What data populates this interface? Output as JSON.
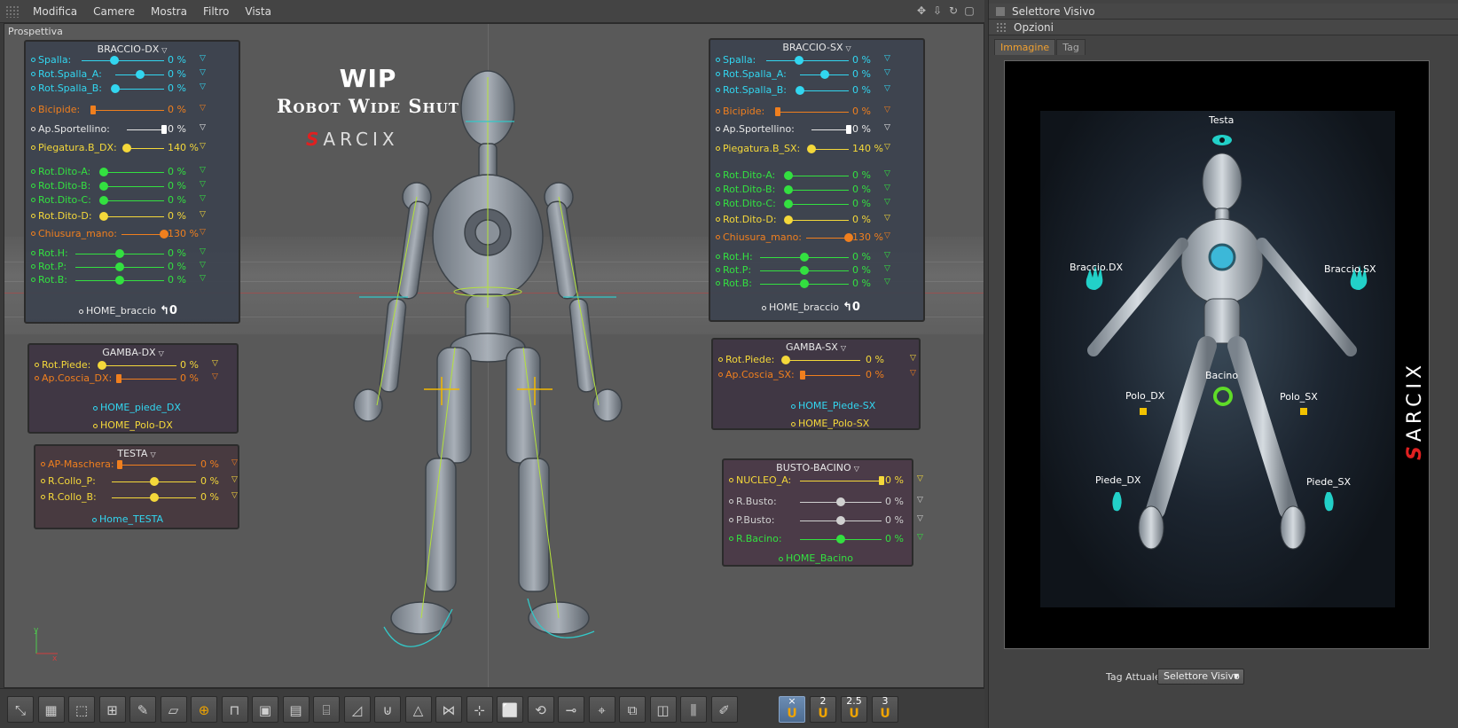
{
  "menubar": {
    "items": [
      "Modifica",
      "Camere",
      "Mostra",
      "Filtro",
      "Vista"
    ]
  },
  "viewport": {
    "label": "Prospettiva",
    "title": "WIP",
    "subtitle": "Robot Wide Shut",
    "brand_first": "S",
    "brand_rest": "ARCIX"
  },
  "colors": {
    "cyan": "#32d6f0",
    "orange": "#f07f1e",
    "white": "#e8e8e8",
    "yellow": "#f4d83a",
    "green": "#33e040",
    "grey": "#d0d0d0",
    "accent_tab": "#f0a030",
    "marker_yellow": "#f2c200"
  },
  "panels": {
    "braccio_dx": {
      "title": "BRACCIO-DX",
      "controls": [
        {
          "label": "Spalla:",
          "value": "0 %",
          "color": "cyan",
          "level": 0.4
        },
        {
          "label": "Rot.Spalla_A:",
          "value": "0 %",
          "color": "cyan",
          "level": 0.5
        },
        {
          "label": "Rot.Spalla_B:",
          "value": "0 %",
          "color": "cyan",
          "level": 0.0
        },
        {
          "label": "Bicipide:",
          "value": "0 %",
          "color": "orange",
          "level": 0.0
        },
        {
          "label": "Ap.Sportellino:",
          "value": "0 %",
          "color": "white",
          "level": 1.0
        },
        {
          "label": "Piegatura.B_DX:",
          "value": "140 %",
          "color": "yellow",
          "level": 0.0
        },
        {
          "label": "Rot.Dito-A:",
          "value": "0 %",
          "color": "green",
          "level": 0.0
        },
        {
          "label": "Rot.Dito-B:",
          "value": "0 %",
          "color": "green",
          "level": 0.0
        },
        {
          "label": "Rot.Dito-C:",
          "value": "0 %",
          "color": "green",
          "level": 0.0
        },
        {
          "label": "Rot.Dito-D:",
          "value": "0 %",
          "color": "yellow",
          "level": 0.0
        },
        {
          "label": "Chiusura_mano:",
          "value": "130 %",
          "color": "orange",
          "level": 1.0
        },
        {
          "label": "Rot.H:",
          "value": "0 %",
          "color": "green",
          "level": 0.5
        },
        {
          "label": "Rot.P:",
          "value": "0 %",
          "color": "green",
          "level": 0.5
        },
        {
          "label": "Rot.B:",
          "value": "0 %",
          "color": "green",
          "level": 0.5
        }
      ],
      "home": "HOME_braccio"
    },
    "braccio_sx": {
      "title": "BRACCIO-SX",
      "controls": [
        {
          "label": "Spalla:",
          "value": "0 %",
          "color": "cyan",
          "level": 0.4
        },
        {
          "label": "Rot.Spalla_A:",
          "value": "0 %",
          "color": "cyan",
          "level": 0.5
        },
        {
          "label": "Rot.Spalla_B:",
          "value": "0 %",
          "color": "cyan",
          "level": 0.0
        },
        {
          "label": "Bicipide:",
          "value": "0 %",
          "color": "orange",
          "level": 0.0
        },
        {
          "label": "Ap.Sportellino:",
          "value": "0 %",
          "color": "white",
          "level": 1.0
        },
        {
          "label": "Piegatura.B_SX:",
          "value": "140 %",
          "color": "yellow",
          "level": 0.0
        },
        {
          "label": "Rot.Dito-A:",
          "value": "0 %",
          "color": "green",
          "level": 0.0
        },
        {
          "label": "Rot.Dito-B:",
          "value": "0 %",
          "color": "green",
          "level": 0.0
        },
        {
          "label": "Rot.Dito-C:",
          "value": "0 %",
          "color": "green",
          "level": 0.0
        },
        {
          "label": "Rot.Dito-D:",
          "value": "0 %",
          "color": "yellow",
          "level": 0.0
        },
        {
          "label": "Chiusura_mano:",
          "value": "130 %",
          "color": "orange",
          "level": 1.0
        },
        {
          "label": "Rot.H:",
          "value": "0 %",
          "color": "green",
          "level": 0.5
        },
        {
          "label": "Rot.P:",
          "value": "0 %",
          "color": "green",
          "level": 0.5
        },
        {
          "label": "Rot.B:",
          "value": "0 %",
          "color": "green",
          "level": 0.5
        }
      ],
      "home": "HOME_braccio"
    },
    "gamba_dx": {
      "title": "GAMBA-DX",
      "controls": [
        {
          "label": "Rot.Piede:",
          "value": "0 %",
          "color": "yellow",
          "level": 0.0
        },
        {
          "label": "Ap.Coscia_DX:",
          "value": "0 %",
          "color": "orange",
          "level": 0.0
        }
      ],
      "home_a": "HOME_piede_DX",
      "home_b": "HOME_Polo-DX"
    },
    "gamba_sx": {
      "title": "GAMBA-SX",
      "controls": [
        {
          "label": "Rot.Piede:",
          "value": "0 %",
          "color": "yellow",
          "level": 0.0
        },
        {
          "label": "Ap.Coscia_SX:",
          "value": "0 %",
          "color": "orange",
          "level": 0.0
        }
      ],
      "home_a": "HOME_Piede-SX",
      "home_b": "HOME_Polo-SX"
    },
    "testa": {
      "title": "TESTA",
      "controls": [
        {
          "label": "AP-Maschera:",
          "value": "0 %",
          "color": "orange",
          "level": 0.0
        },
        {
          "label": "R.Collo_P:",
          "value": "0 %",
          "color": "yellow",
          "level": 0.5
        },
        {
          "label": "R.Collo_B:",
          "value": "0 %",
          "color": "yellow",
          "level": 0.5
        }
      ],
      "home": "Home_TESTA"
    },
    "busto_bacino": {
      "title": "BUSTO-BACINO",
      "controls": [
        {
          "label": "NUCLEO_A:",
          "value": "0 %",
          "color": "yellow",
          "level": 1.0
        },
        {
          "label": "R.Busto:",
          "value": "0 %",
          "color": "grey",
          "level": 0.5
        },
        {
          "label": "P.Busto:",
          "value": "0 %",
          "color": "grey",
          "level": 0.5
        },
        {
          "label": "R.Bacino:",
          "value": "0 %",
          "color": "green",
          "level": 0.5
        }
      ],
      "home": "HOME_Bacino"
    }
  },
  "toolbar": {
    "icons": [
      "move-tool-icon",
      "grid-tool-icon",
      "cube-tool-icon",
      "nodes-tool-icon",
      "brush-tool-icon",
      "plane-tool-icon",
      "add-object-icon",
      "bench-icon",
      "box-icon",
      "sheet-icon",
      "stairs-icon",
      "ramp-icon",
      "magnet-icon",
      "cone-icon",
      "mirror-icon",
      "crosshair-icon",
      "frame-icon",
      "rotate-icon",
      "path-icon",
      "camera-icon",
      "layers-icon",
      "box-3d-icon",
      "bars-icon",
      "paint-icon"
    ],
    "snap_buttons": [
      {
        "label": "×",
        "icon": "magnet-icon"
      },
      {
        "label": "2",
        "icon": "magnet-icon"
      },
      {
        "label": "2.5",
        "icon": "magnet-icon"
      },
      {
        "label": "3",
        "icon": "magnet-icon"
      }
    ],
    "magnet_glyph": "U"
  },
  "right_panel": {
    "title": "Selettore Visivo",
    "options_label": "Opzioni",
    "tabs": [
      "Immagine",
      "Tag"
    ],
    "picker": {
      "labels": {
        "testa": "Testa",
        "braccio_dx": "Braccio.DX",
        "braccio_sx": "Braccio.SX",
        "bacino": "Bacino",
        "polo_dx": "Polo_DX",
        "polo_sx": "Polo_SX",
        "piede_dx": "Piede_DX",
        "piede_sx": "Piede_SX"
      },
      "brand_first": "S",
      "brand_rest": "ARCIX"
    },
    "tag_label": "Tag Attuale",
    "tag_value": "Selettore Visivo"
  }
}
